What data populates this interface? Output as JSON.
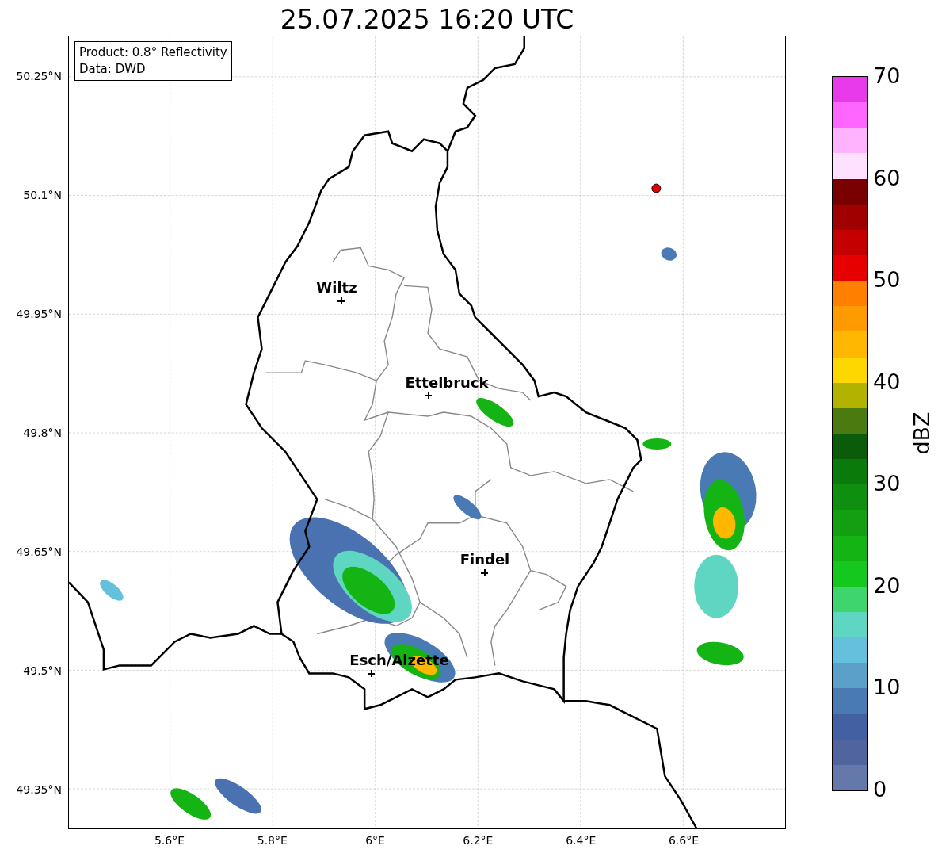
{
  "title": "25.07.2025 16:20 UTC",
  "info_box": [
    "Product: 0.8° Reflectivity",
    "Data: DWD"
  ],
  "lat_labels": [
    "50.25°N",
    "50.1°N",
    "49.95°N",
    "49.8°N",
    "49.65°N",
    "49.5°N",
    "49.35°N"
  ],
  "lon_labels": [
    "5.6°E",
    "5.8°E",
    "6°E",
    "6.2°E",
    "6.4°E",
    "6.6°E"
  ],
  "cities": [
    {
      "name": "Wiltz"
    },
    {
      "name": "Ettelbruck"
    },
    {
      "name": "Findel"
    },
    {
      "name": "Esch/Alzette"
    }
  ],
  "colorbar": {
    "label": "dBZ",
    "ticks": [
      "70",
      "60",
      "50",
      "40",
      "30",
      "20",
      "10",
      "0"
    ],
    "bins": [
      {
        "color": "#e93ae9"
      },
      {
        "color": "#ff66ff"
      },
      {
        "color": "#ffb3ff"
      },
      {
        "color": "#ffe0ff"
      },
      {
        "color": "#7a0000"
      },
      {
        "color": "#a00000"
      },
      {
        "color": "#c40000"
      },
      {
        "color": "#e60000"
      },
      {
        "color": "#ff7f00"
      },
      {
        "color": "#ff9a00"
      },
      {
        "color": "#ffb700"
      },
      {
        "color": "#ffd700"
      },
      {
        "color": "#b2b200"
      },
      {
        "color": "#4a7a10"
      },
      {
        "color": "#0a5c0a"
      },
      {
        "color": "#0a7a0a"
      },
      {
        "color": "#0f8f0f"
      },
      {
        "color": "#12a012"
      },
      {
        "color": "#14b414"
      },
      {
        "color": "#14c81e"
      },
      {
        "color": "#3ed46e"
      },
      {
        "color": "#5fd6c2"
      },
      {
        "color": "#64c0dc"
      },
      {
        "color": "#5aa0c8"
      },
      {
        "color": "#4a7ab4"
      },
      {
        "color": "#4260a2"
      },
      {
        "color": "#50649e"
      },
      {
        "color": "#6478aa"
      }
    ]
  }
}
